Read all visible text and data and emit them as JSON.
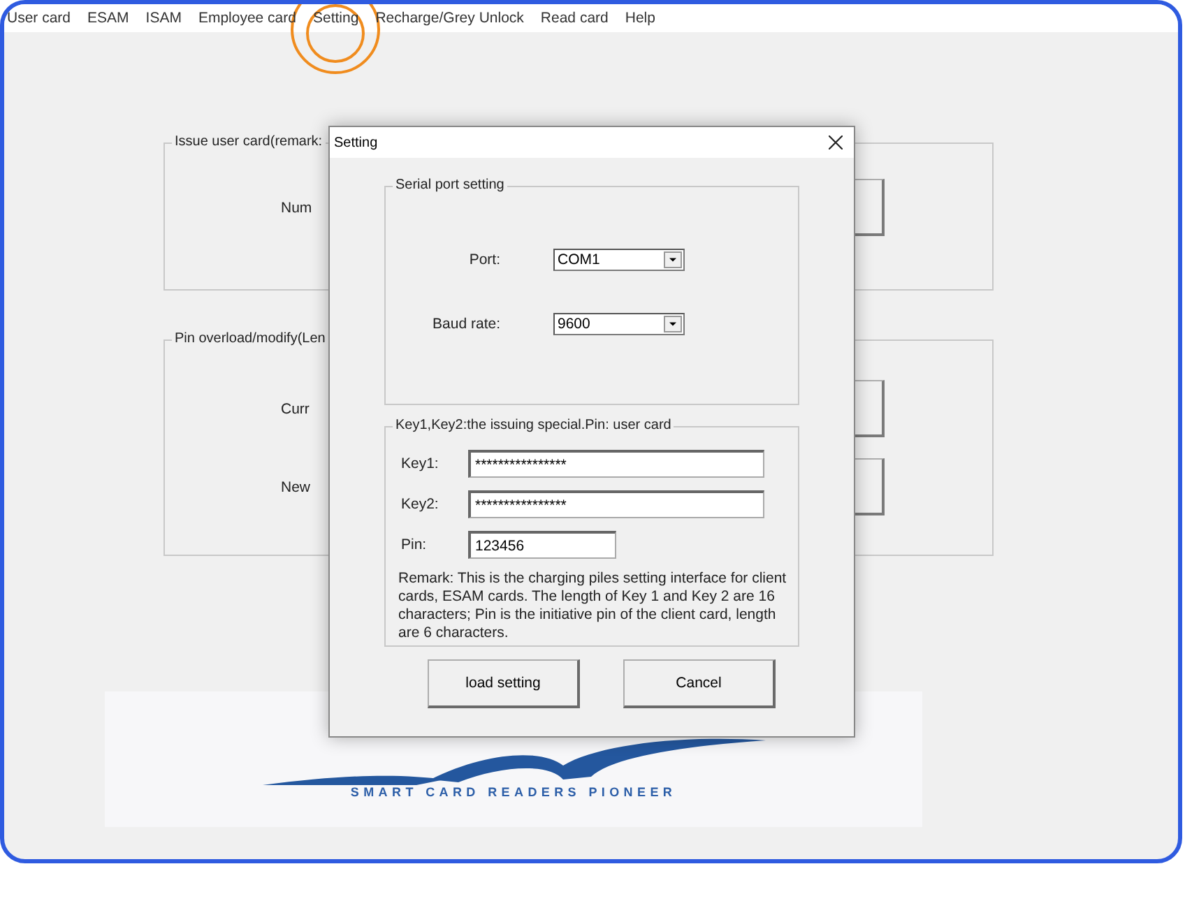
{
  "menu": [
    {
      "label": "User card",
      "highlighted": false
    },
    {
      "label": "ESAM",
      "highlighted": false
    },
    {
      "label": "ISAM",
      "highlighted": false
    },
    {
      "label": "Employee card",
      "highlighted": false
    },
    {
      "label": "Setting",
      "highlighted": true
    },
    {
      "label": "Recharge/Grey Unlock",
      "highlighted": false
    },
    {
      "label": "Read card",
      "highlighted": false
    },
    {
      "label": "Help",
      "highlighted": false
    }
  ],
  "background_groups": [
    {
      "legend": "Issue user card(remark:",
      "fields": [
        "Num"
      ]
    },
    {
      "legend": "Pin overload/modify(Len",
      "fields": [
        "Curr",
        "New"
      ]
    }
  ],
  "logo": {
    "tagline": "SMART CARD READERS PIONEER"
  },
  "dialog": {
    "title": "Setting",
    "serial_group": {
      "legend": "Serial port setting",
      "fields": [
        {
          "label": "Port:",
          "value": "COM1"
        },
        {
          "label": "Baud rate:",
          "value": "9600"
        }
      ]
    },
    "key_group": {
      "legend": "Key1,Key2:the issuing special.Pin: user card",
      "fields": [
        {
          "label": "Key1:",
          "value": "****************",
          "kind": "wide"
        },
        {
          "label": "Key2:",
          "value": "****************",
          "kind": "wide"
        },
        {
          "label": "Pin:",
          "value": "123456",
          "kind": "short"
        }
      ],
      "remark": "Remark: This is the charging piles setting interface for client cards, ESAM cards. The length of Key 1 and Key 2 are 16 characters; Pin is the initiative pin of the client card, length are 6 characters."
    },
    "buttons": [
      "load setting",
      "Cancel"
    ]
  }
}
